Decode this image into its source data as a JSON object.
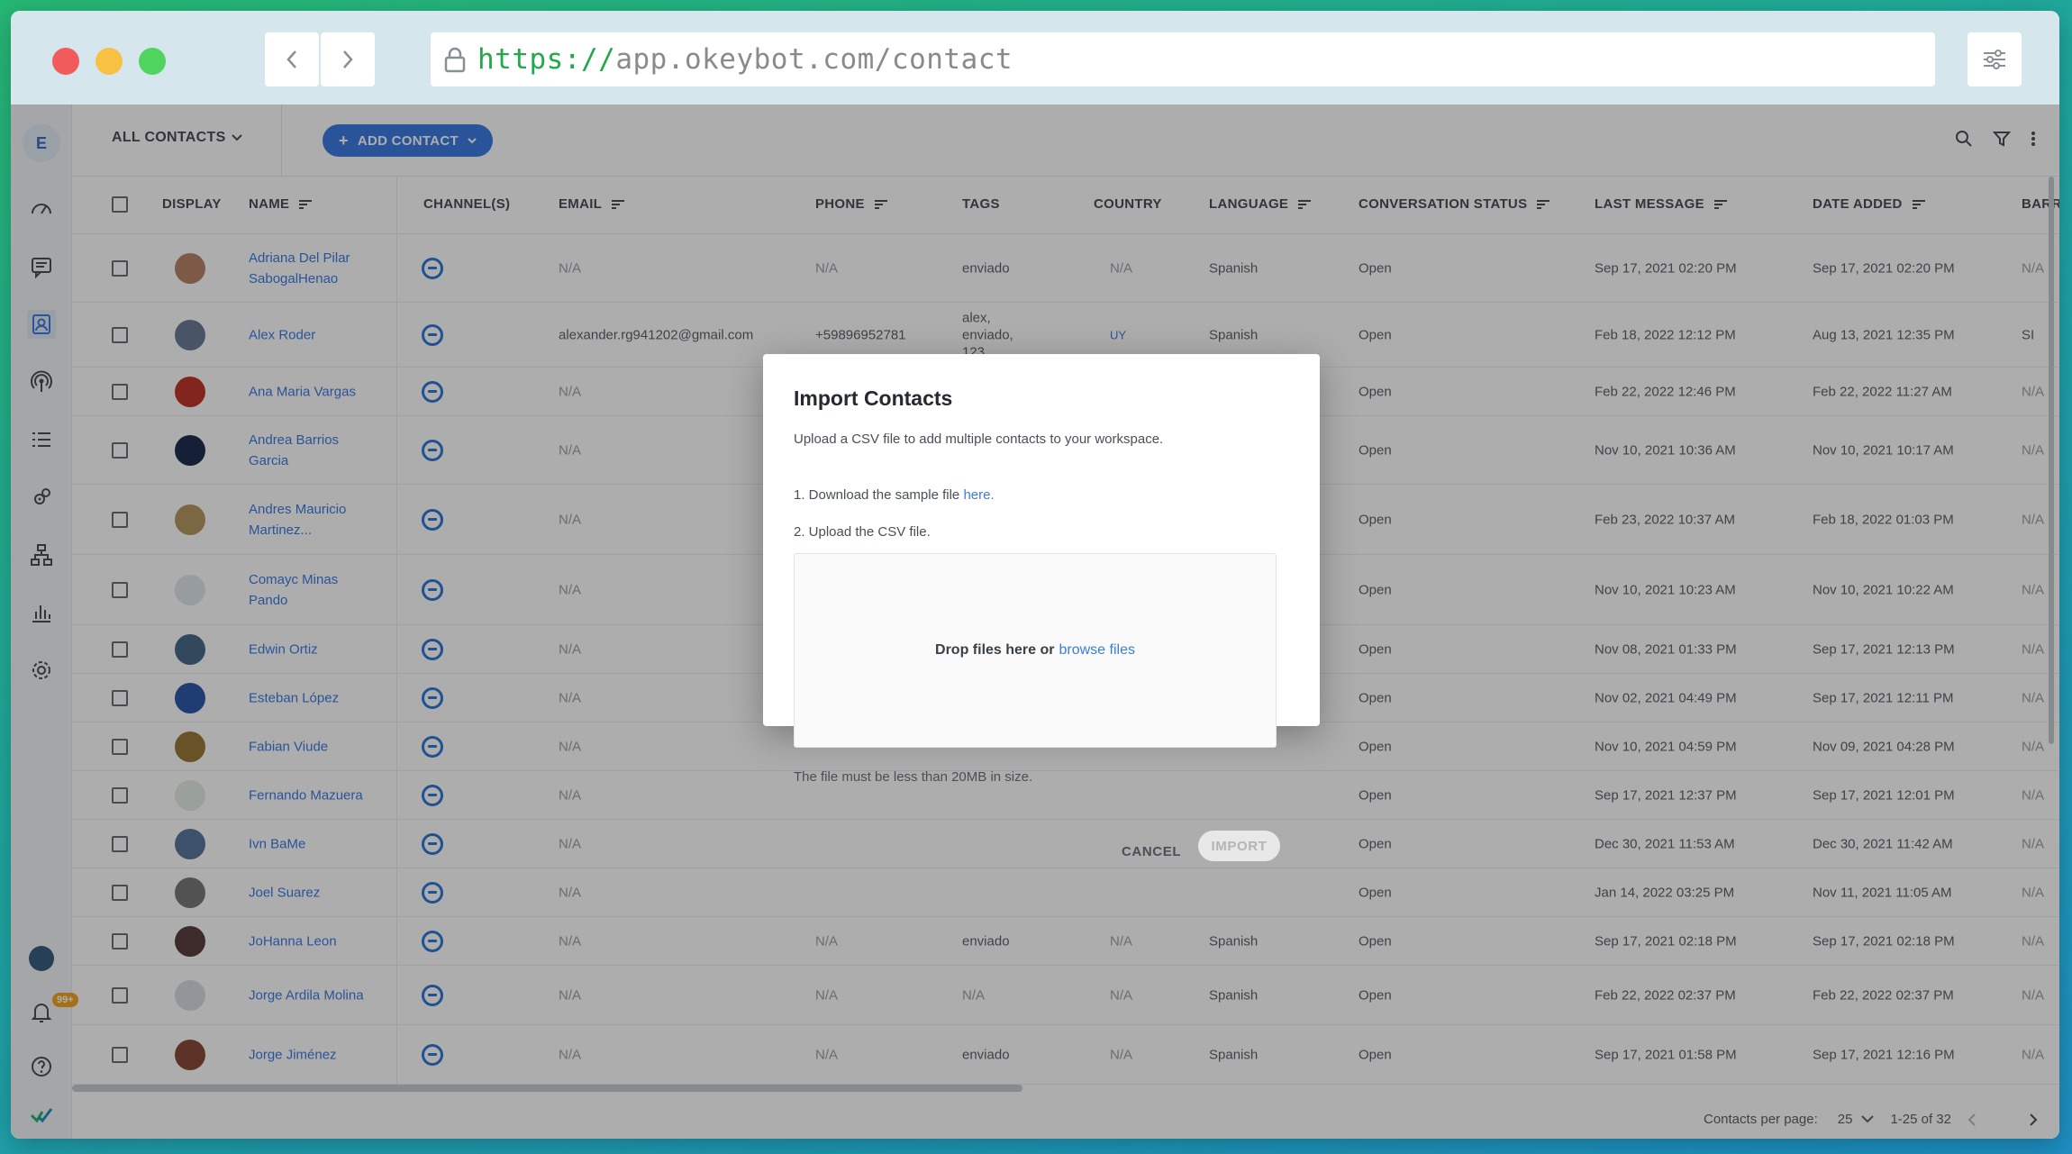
{
  "browser": {
    "url_protocol": "https://",
    "url_rest": "app.okeybot.com/contact"
  },
  "sidebar": {
    "avatar_initial": "E",
    "notification_badge": "99+",
    "items": [
      "dashboard-icon",
      "chat-icon",
      "contacts-icon",
      "broadcast-icon",
      "list-icon",
      "integrations-icon",
      "flows-icon",
      "analytics-icon",
      "settings-icon"
    ]
  },
  "toolbar": {
    "filter_label": "ALL CONTACTS",
    "add_contact_label": "ADD CONTACT"
  },
  "table": {
    "headers": {
      "display": "DISPLAY",
      "name": "NAME",
      "channels": "CHANNEL(S)",
      "email": "EMAIL",
      "phone": "PHONE",
      "tags": "TAGS",
      "country": "COUNTRY",
      "language": "LANGUAGE",
      "status": "CONVERSATION STATUS",
      "last_message": "LAST MESSAGE",
      "date_added": "DATE ADDED",
      "extra": "BARR"
    },
    "rows": [
      {
        "name": "Adriana Del Pilar SabogalHenao",
        "email": "N/A",
        "phone": "N/A",
        "tags": "enviado",
        "country": "N/A",
        "language": "Spanish",
        "status": "Open",
        "last_message": "Sep 17, 2021 02:20 PM",
        "date_added": "Sep 17, 2021 02:20 PM",
        "extra": "N/A",
        "avatar": "#b8846b"
      },
      {
        "name": "Alex Roder",
        "email": "alexander.rg941202@gmail.com",
        "phone": "+59896952781",
        "tags": "alex, enviado, 123",
        "country": "UY",
        "language": "Spanish",
        "status": "Open",
        "last_message": "Feb 18, 2022 12:12 PM",
        "date_added": "Aug 13, 2021 12:35 PM",
        "extra": "SI",
        "avatar": "#6e7d99"
      },
      {
        "name": "Ana Maria Vargas",
        "email": "N/A",
        "phone": "",
        "tags": "",
        "country": "",
        "language": "",
        "status": "Open",
        "last_message": "Feb 22, 2022 12:46 PM",
        "date_added": "Feb 22, 2022 11:27 AM",
        "extra": "N/A",
        "avatar": "#c0392b"
      },
      {
        "name": "Andrea Barrios Garcia",
        "email": "N/A",
        "phone": "",
        "tags": "",
        "country": "",
        "language": "",
        "status": "Open",
        "last_message": "Nov 10, 2021 10:36 AM",
        "date_added": "Nov 10, 2021 10:17 AM",
        "extra": "N/A",
        "avatar": "#1f2f4f"
      },
      {
        "name": "Andres Mauricio Martinez...",
        "email": "N/A",
        "phone": "",
        "tags": "",
        "country": "",
        "language": "",
        "status": "Open",
        "last_message": "Feb 23, 2022 10:37 AM",
        "date_added": "Feb 18, 2022 01:03 PM",
        "extra": "N/A",
        "avatar": "#b59a62"
      },
      {
        "name": "Comayc Minas Pando",
        "email": "N/A",
        "phone": "",
        "tags": "",
        "country": "",
        "language": "",
        "status": "Open",
        "last_message": "Nov 10, 2021 10:23 AM",
        "date_added": "Nov 10, 2021 10:22 AM",
        "extra": "N/A",
        "avatar": "#dfe6ee"
      },
      {
        "name": "Edwin Ortiz",
        "email": "N/A",
        "phone": "",
        "tags": "",
        "country": "",
        "language": "",
        "status": "Open",
        "last_message": "Nov 08, 2021 01:33 PM",
        "date_added": "Sep 17, 2021 12:13 PM",
        "extra": "N/A",
        "avatar": "#4a6a8a"
      },
      {
        "name": "Esteban López",
        "email": "N/A",
        "phone": "",
        "tags": "",
        "country": "",
        "language": "",
        "status": "Open",
        "last_message": "Nov 02, 2021 04:49 PM",
        "date_added": "Sep 17, 2021 12:11 PM",
        "extra": "N/A",
        "avatar": "#2e5aa8"
      },
      {
        "name": "Fabian Viude",
        "email": "N/A",
        "phone": "",
        "tags": "",
        "country": "",
        "language": "",
        "status": "Open",
        "last_message": "Nov 10, 2021 04:59 PM",
        "date_added": "Nov 09, 2021 04:28 PM",
        "extra": "N/A",
        "avatar": "#9c7a3c"
      },
      {
        "name": "Fernando Mazuera",
        "email": "N/A",
        "phone": "",
        "tags": "",
        "country": "",
        "language": "",
        "status": "Open",
        "last_message": "Sep 17, 2021 12:37 PM",
        "date_added": "Sep 17, 2021 12:01 PM",
        "extra": "N/A",
        "avatar": "#e4ece4"
      },
      {
        "name": "Ivn BaMe",
        "email": "N/A",
        "phone": "",
        "tags": "",
        "country": "",
        "language": "",
        "status": "Open",
        "last_message": "Dec 30, 2021 11:53 AM",
        "date_added": "Dec 30, 2021 11:42 AM",
        "extra": "N/A",
        "avatar": "#5b7a9c"
      },
      {
        "name": "Joel Suarez",
        "email": "N/A",
        "phone": "",
        "tags": "",
        "country": "",
        "language": "",
        "status": "Open",
        "last_message": "Jan 14, 2022 03:25 PM",
        "date_added": "Nov 11, 2021 11:05 AM",
        "extra": "N/A",
        "avatar": "#7a7a7a"
      },
      {
        "name": "JoHanna Leon",
        "email": "N/A",
        "phone": "N/A",
        "tags": "enviado",
        "country": "N/A",
        "language": "Spanish",
        "status": "Open",
        "last_message": "Sep 17, 2021 02:18 PM",
        "date_added": "Sep 17, 2021 02:18 PM",
        "extra": "N/A",
        "avatar": "#5a4040"
      },
      {
        "name": "Jorge Ardila Molina",
        "email": "N/A",
        "phone": "N/A",
        "tags": "N/A",
        "country": "N/A",
        "language": "Spanish",
        "status": "Open",
        "last_message": "Feb 22, 2022 02:37 PM",
        "date_added": "Feb 22, 2022 02:37 PM",
        "extra": "N/A",
        "avatar": "#d8dde3"
      },
      {
        "name": "Jorge Jiménez",
        "email": "N/A",
        "phone": "N/A",
        "tags": "enviado",
        "country": "N/A",
        "language": "Spanish",
        "status": "Open",
        "last_message": "Sep 17, 2021 01:58 PM",
        "date_added": "Sep 17, 2021 12:16 PM",
        "extra": "N/A",
        "avatar": "#8a4a3a"
      }
    ]
  },
  "footer": {
    "per_page_label": "Contacts per page:",
    "per_page_value": "25",
    "range": "1-25 of 32"
  },
  "modal": {
    "title": "Import Contacts",
    "subtitle": "Upload a CSV file to add multiple contacts to your workspace.",
    "step1_prefix": "1. Download the sample file ",
    "step1_link": "here",
    "step1_suffix": ".",
    "step2": "2. Upload the CSV file.",
    "drop_text": "Drop files here or",
    "browse_link": "browse files",
    "size_note": "The file must be less than 20MB in size.",
    "cancel_label": "CANCEL",
    "import_label": "IMPORT"
  }
}
